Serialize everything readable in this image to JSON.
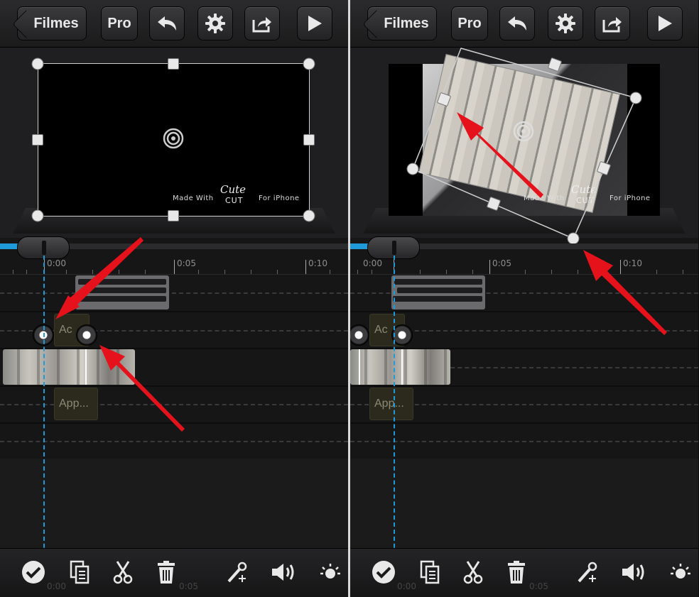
{
  "toolbar": {
    "back_label": "Filmes",
    "pro_label": "Pro",
    "icons": [
      "undo-icon",
      "gear-icon",
      "share-icon",
      "play-icon"
    ]
  },
  "preview": {
    "watermark_left": "Made With",
    "watermark_brand_script": "Cute",
    "watermark_brand_caps": "CUT",
    "watermark_right": "For iPhone"
  },
  "timeline": {
    "tick_labels": [
      "0:00",
      "0:05",
      "0:10"
    ],
    "text_clip_1": "Ac",
    "text_clip_2": "App..."
  },
  "bottom_toolbar": {
    "icons": [
      "check-icon",
      "copy-icon",
      "scissors-icon",
      "trash-icon",
      "magic-wand-icon",
      "volume-icon",
      "brightness-icon"
    ],
    "ghost_labels": [
      "0:00",
      "0:05"
    ]
  },
  "colors": {
    "accent": "#1f9ad8",
    "annotation_arrow": "#e5121c",
    "toolbar_bg": "#2b2b2d"
  }
}
